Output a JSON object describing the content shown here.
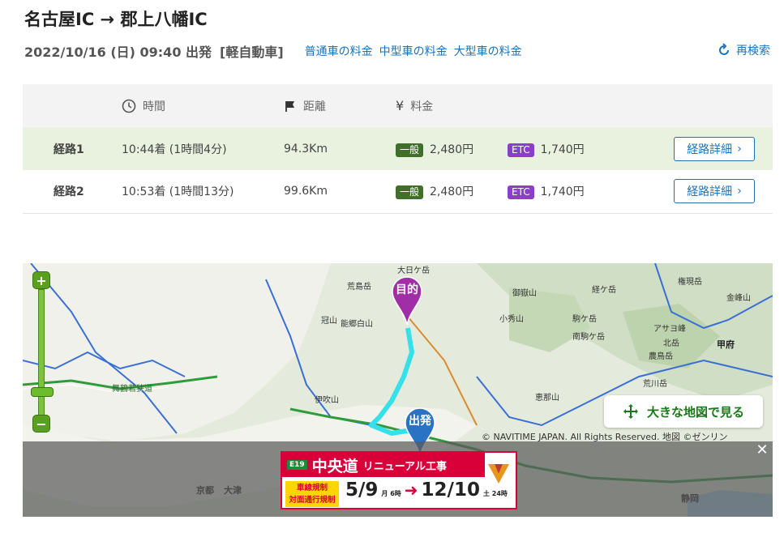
{
  "header": {
    "title": "名古屋IC → 郡上八幡IC",
    "datetime": "2022/10/16 (日) 09:40 出発",
    "vehicle": "[軽自動車]",
    "fare_links": [
      "普通車の料金",
      "中型車の料金",
      "大型車の料金"
    ],
    "research_label": "再検索"
  },
  "table": {
    "headers": {
      "time": "時間",
      "distance": "距離",
      "fare": "料金"
    },
    "routes": [
      {
        "name": "経路1",
        "time": "10:44着 (1時間4分)",
        "distance": "94.3Km",
        "general_badge": "一般",
        "general_fare": "2,480円",
        "etc_badge": "ETC",
        "etc_fare": "1,740円",
        "detail_label": "経路詳細"
      },
      {
        "name": "経路2",
        "time": "10:53着 (1時間13分)",
        "distance": "99.6Km",
        "general_badge": "一般",
        "general_fare": "2,480円",
        "etc_badge": "ETC",
        "etc_fare": "1,740円",
        "detail_label": "経路詳細"
      }
    ]
  },
  "map": {
    "zoom_in": "+",
    "zoom_out": "−",
    "big_map_label": "大きな地図で見る",
    "copyright": "© NAVITIME JAPAN. All Rights Reserved. 地図 ©ゼンリン",
    "destination_pin": "目的",
    "start_pin": "出発",
    "places": [
      "大日ケ岳",
      "荒島岳",
      "冠山",
      "能郷白山",
      "御嶽山",
      "経ケ岳",
      "権現岳",
      "金峰山",
      "小秀山",
      "駒ケ岳",
      "南駒ケ岳",
      "アサヨ峰",
      "北岳",
      "農鳥岳",
      "荒川岳",
      "甲府",
      "伊吹山",
      "恵那山",
      "舞鶴若狭道",
      "京都",
      "大津",
      "静岡"
    ],
    "route_color": "#35e0e8"
  },
  "ad": {
    "close": "✕",
    "route_tag": "E19",
    "title": "中央道",
    "subtitle": "リニューアル工事",
    "restriction_1": "車線規制",
    "restriction_2": "対面通行規制",
    "date_from": "5/9",
    "date_from_note": "月 6時",
    "arrow": "➜",
    "date_to": "12/10",
    "date_to_note": "土 24時"
  }
}
